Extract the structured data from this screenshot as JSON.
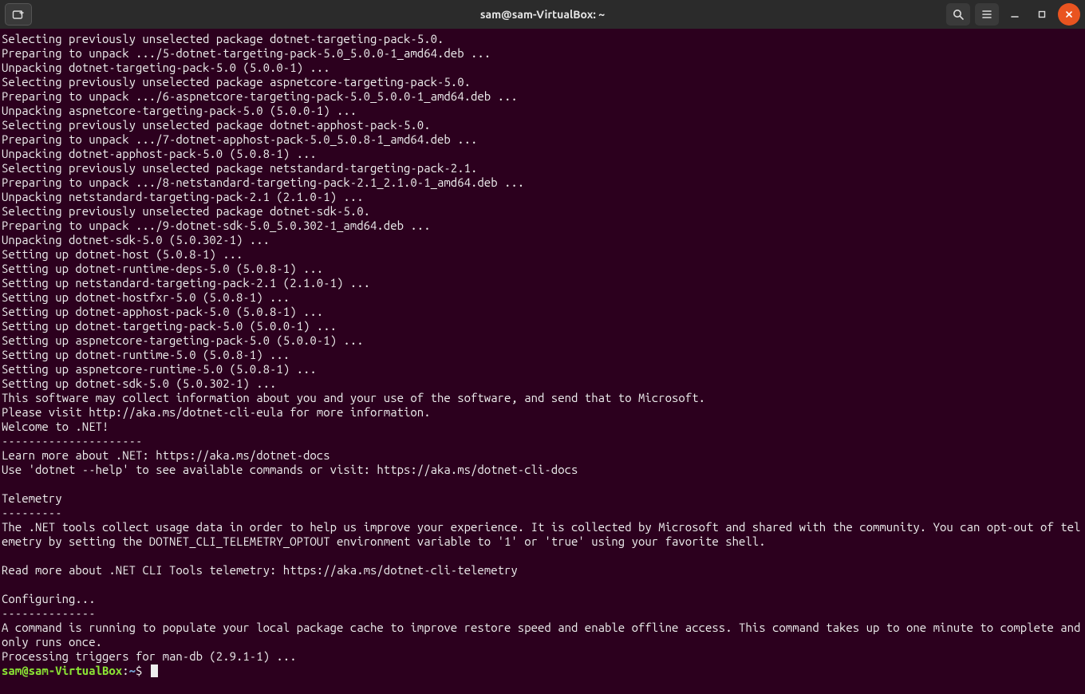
{
  "titlebar": {
    "title": "sam@sam-VirtualBox: ~"
  },
  "prompt": {
    "user_host": "sam@sam-VirtualBox",
    "separator": ":",
    "path": "~",
    "symbol": "$"
  },
  "terminal_lines": [
    "Selecting previously unselected package dotnet-targeting-pack-5.0.",
    "Preparing to unpack .../5-dotnet-targeting-pack-5.0_5.0.0-1_amd64.deb ...",
    "Unpacking dotnet-targeting-pack-5.0 (5.0.0-1) ...",
    "Selecting previously unselected package aspnetcore-targeting-pack-5.0.",
    "Preparing to unpack .../6-aspnetcore-targeting-pack-5.0_5.0.0-1_amd64.deb ...",
    "Unpacking aspnetcore-targeting-pack-5.0 (5.0.0-1) ...",
    "Selecting previously unselected package dotnet-apphost-pack-5.0.",
    "Preparing to unpack .../7-dotnet-apphost-pack-5.0_5.0.8-1_amd64.deb ...",
    "Unpacking dotnet-apphost-pack-5.0 (5.0.8-1) ...",
    "Selecting previously unselected package netstandard-targeting-pack-2.1.",
    "Preparing to unpack .../8-netstandard-targeting-pack-2.1_2.1.0-1_amd64.deb ...",
    "Unpacking netstandard-targeting-pack-2.1 (2.1.0-1) ...",
    "Selecting previously unselected package dotnet-sdk-5.0.",
    "Preparing to unpack .../9-dotnet-sdk-5.0_5.0.302-1_amd64.deb ...",
    "Unpacking dotnet-sdk-5.0 (5.0.302-1) ...",
    "Setting up dotnet-host (5.0.8-1) ...",
    "Setting up dotnet-runtime-deps-5.0 (5.0.8-1) ...",
    "Setting up netstandard-targeting-pack-2.1 (2.1.0-1) ...",
    "Setting up dotnet-hostfxr-5.0 (5.0.8-1) ...",
    "Setting up dotnet-apphost-pack-5.0 (5.0.8-1) ...",
    "Setting up dotnet-targeting-pack-5.0 (5.0.0-1) ...",
    "Setting up aspnetcore-targeting-pack-5.0 (5.0.0-1) ...",
    "Setting up dotnet-runtime-5.0 (5.0.8-1) ...",
    "Setting up aspnetcore-runtime-5.0 (5.0.8-1) ...",
    "Setting up dotnet-sdk-5.0 (5.0.302-1) ...",
    "This software may collect information about you and your use of the software, and send that to Microsoft.",
    "Please visit http://aka.ms/dotnet-cli-eula for more information.",
    "Welcome to .NET!",
    "---------------------",
    "Learn more about .NET: https://aka.ms/dotnet-docs",
    "Use 'dotnet --help' to see available commands or visit: https://aka.ms/dotnet-cli-docs",
    "",
    "Telemetry",
    "---------",
    "The .NET tools collect usage data in order to help us improve your experience. It is collected by Microsoft and shared with the community. You can opt-out of telemetry by setting the DOTNET_CLI_TELEMETRY_OPTOUT environment variable to '1' or 'true' using your favorite shell.",
    "",
    "Read more about .NET CLI Tools telemetry: https://aka.ms/dotnet-cli-telemetry",
    "",
    "Configuring...",
    "--------------",
    "A command is running to populate your local package cache to improve restore speed and enable offline access. This command takes up to one minute to complete and only runs once.",
    "Processing triggers for man-db (2.9.1-1) ..."
  ]
}
